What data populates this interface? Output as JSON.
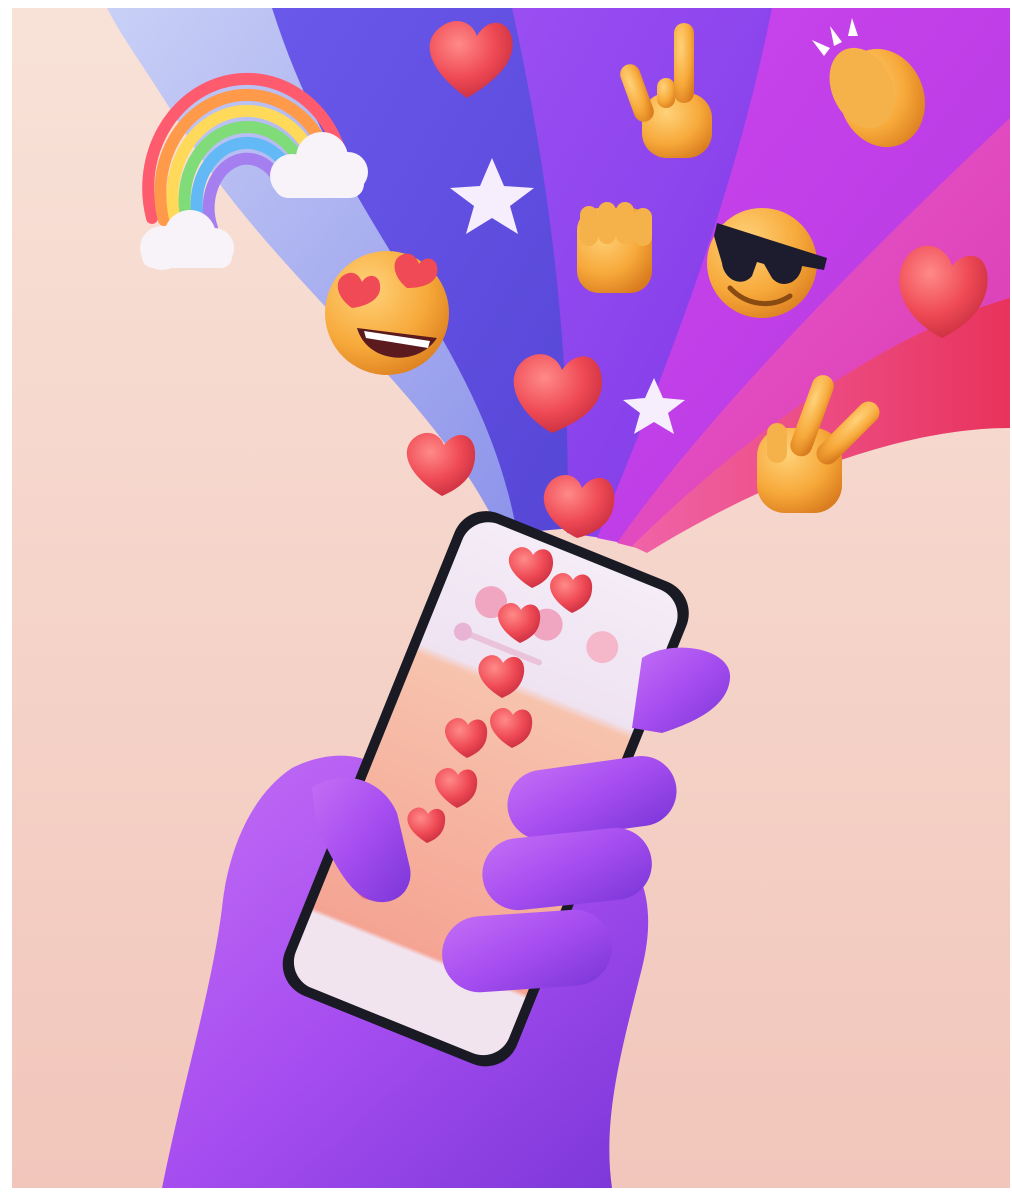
{
  "scene": {
    "background_colors": [
      "#f7ddd3",
      "#f3c9bd"
    ],
    "hand_color": "#a64df0",
    "phone_screen_colors": [
      "#f0e6f4",
      "#f7b8a6"
    ],
    "ribbon_colors": [
      "#b9c4f2",
      "#6b52e8",
      "#8f45f0",
      "#c23de8",
      "#e244c0",
      "#e83a7a"
    ],
    "heart_color": "#ef4a55",
    "emoji_color": "#f7a93a",
    "elements": [
      "rainbow",
      "cloud",
      "heart",
      "star",
      "rock-on-hand",
      "clapping-hands",
      "raised-fist",
      "sunglasses-face",
      "heart-eyes-face",
      "peace-hand",
      "smartphone",
      "hand"
    ]
  }
}
